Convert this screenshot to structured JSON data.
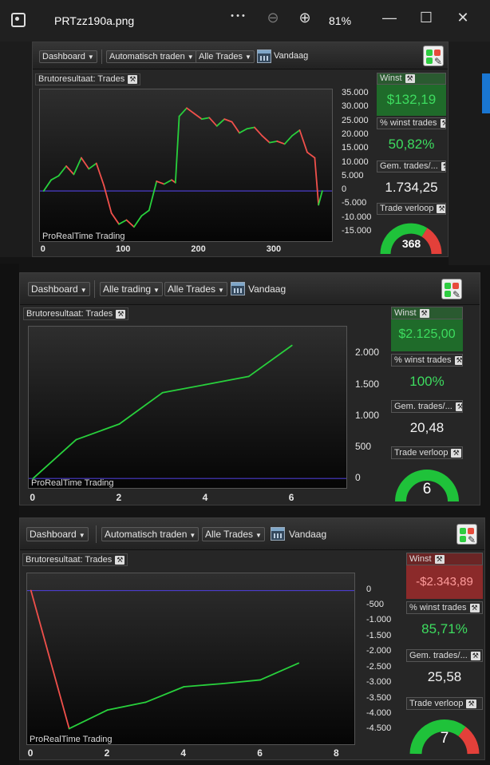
{
  "viewer": {
    "file_title": "PRTzz190a.png",
    "more_label": "• • •",
    "zoom_level": "81%"
  },
  "colors": {
    "line_up": "#28d03c",
    "line_down": "#f0504b",
    "zero_line": "#4b3ccc",
    "gauge_green": "#1fc23a",
    "gauge_red": "#e3403a"
  },
  "panels": [
    {
      "toolbar": {
        "dashboard": "Dashboard",
        "trading": "Automatisch traden",
        "trades": "Alle Trades",
        "today": "Vandaag"
      },
      "chart_title": "Brutoresultaat: Trades",
      "watermark": "ProRealTime Trading",
      "stats": {
        "winst_label": "Winst",
        "winst_value": "$132,19",
        "pct_label": "% winst trades",
        "pct_value": "50,82%",
        "gem_label": "Gem. trades/...",
        "gem_value": "1.734,25",
        "verloop_label": "Trade verloop",
        "verloop_value": "368"
      }
    },
    {
      "toolbar": {
        "dashboard": "Dashboard",
        "trading": "Alle trading",
        "trades": "Alle Trades",
        "today": "Vandaag"
      },
      "chart_title": "Brutoresultaat: Trades",
      "watermark": "ProRealTime Trading",
      "stats": {
        "winst_label": "Winst",
        "winst_value": "$2.125,00",
        "pct_label": "% winst trades",
        "pct_value": "100%",
        "gem_label": "Gem. trades/...",
        "gem_value": "20,48",
        "verloop_label": "Trade verloop",
        "verloop_value": "6"
      }
    },
    {
      "toolbar": {
        "dashboard": "Dashboard",
        "trading": "Automatisch traden",
        "trades": "Alle Trades",
        "today": "Vandaag"
      },
      "chart_title": "Brutoresultaat: Trades",
      "watermark": "ProRealTime Trading",
      "stats": {
        "winst_label": "Winst",
        "winst_value": "-$2.343,89",
        "pct_label": "% winst trades",
        "pct_value": "85,71%",
        "gem_label": "Gem. trades/...",
        "gem_value": "25,58",
        "verloop_label": "Trade verloop",
        "verloop_value": "7"
      }
    }
  ],
  "chart_data": [
    {
      "type": "line",
      "x": [
        0,
        10,
        20,
        30,
        40,
        50,
        60,
        70,
        80,
        90,
        100,
        110,
        120,
        130,
        140,
        150,
        160,
        170,
        175,
        180,
        190,
        200,
        210,
        220,
        230,
        240,
        250,
        260,
        270,
        280,
        290,
        300,
        310,
        320,
        330,
        340,
        350,
        360,
        365,
        370
      ],
      "values": [
        0,
        4000,
        5500,
        9000,
        6000,
        12000,
        8000,
        10000,
        2000,
        -8000,
        -12000,
        -10500,
        -13000,
        -9000,
        -7000,
        3500,
        2500,
        4000,
        3000,
        27000,
        30000,
        28000,
        26000,
        26500,
        23500,
        26000,
        25000,
        21000,
        22500,
        23000,
        20000,
        17500,
        18000,
        17000,
        20000,
        22000,
        14000,
        12000,
        -5000,
        0
      ],
      "ylim": [
        -17000,
        35000
      ],
      "xlim": [
        -5,
        385
      ],
      "yticks": [
        "35.000",
        "30.000",
        "25.000",
        "20.000",
        "15.000",
        "10.000",
        "5.000",
        "0",
        "-5.000",
        "-10.000",
        "-15.000"
      ],
      "xticks": [
        "0",
        "100",
        "200",
        "300"
      ],
      "ylabel": "",
      "xlabel": "",
      "grid": false
    },
    {
      "type": "line",
      "x": [
        0,
        1,
        2,
        3,
        4,
        5,
        6
      ],
      "values": [
        0,
        620,
        870,
        1370,
        1500,
        1630,
        2125
      ],
      "ylim": [
        -100,
        2350
      ],
      "xlim": [
        -0.1,
        7.3
      ],
      "yticks": [
        "2.000",
        "1.500",
        "1.000",
        "500",
        "0"
      ],
      "xticks": [
        "0",
        "2",
        "4",
        "6"
      ],
      "ylabel": "",
      "xlabel": "",
      "grid": false
    },
    {
      "type": "line",
      "x": [
        0,
        1,
        2,
        3,
        4,
        5,
        6,
        7
      ],
      "values": [
        0,
        -4450,
        -3850,
        -3600,
        -3100,
        -3000,
        -2880,
        -2340
      ],
      "ylim": [
        -4850,
        400
      ],
      "xlim": [
        -0.1,
        8.5
      ],
      "yticks": [
        "0",
        "-500",
        "-1.000",
        "-1.500",
        "-2.000",
        "-2.500",
        "-3.000",
        "-3.500",
        "-4.000",
        "-4.500"
      ],
      "xticks": [
        "0",
        "2",
        "4",
        "6",
        "8"
      ],
      "ylabel": "",
      "xlabel": "",
      "grid": false
    }
  ]
}
